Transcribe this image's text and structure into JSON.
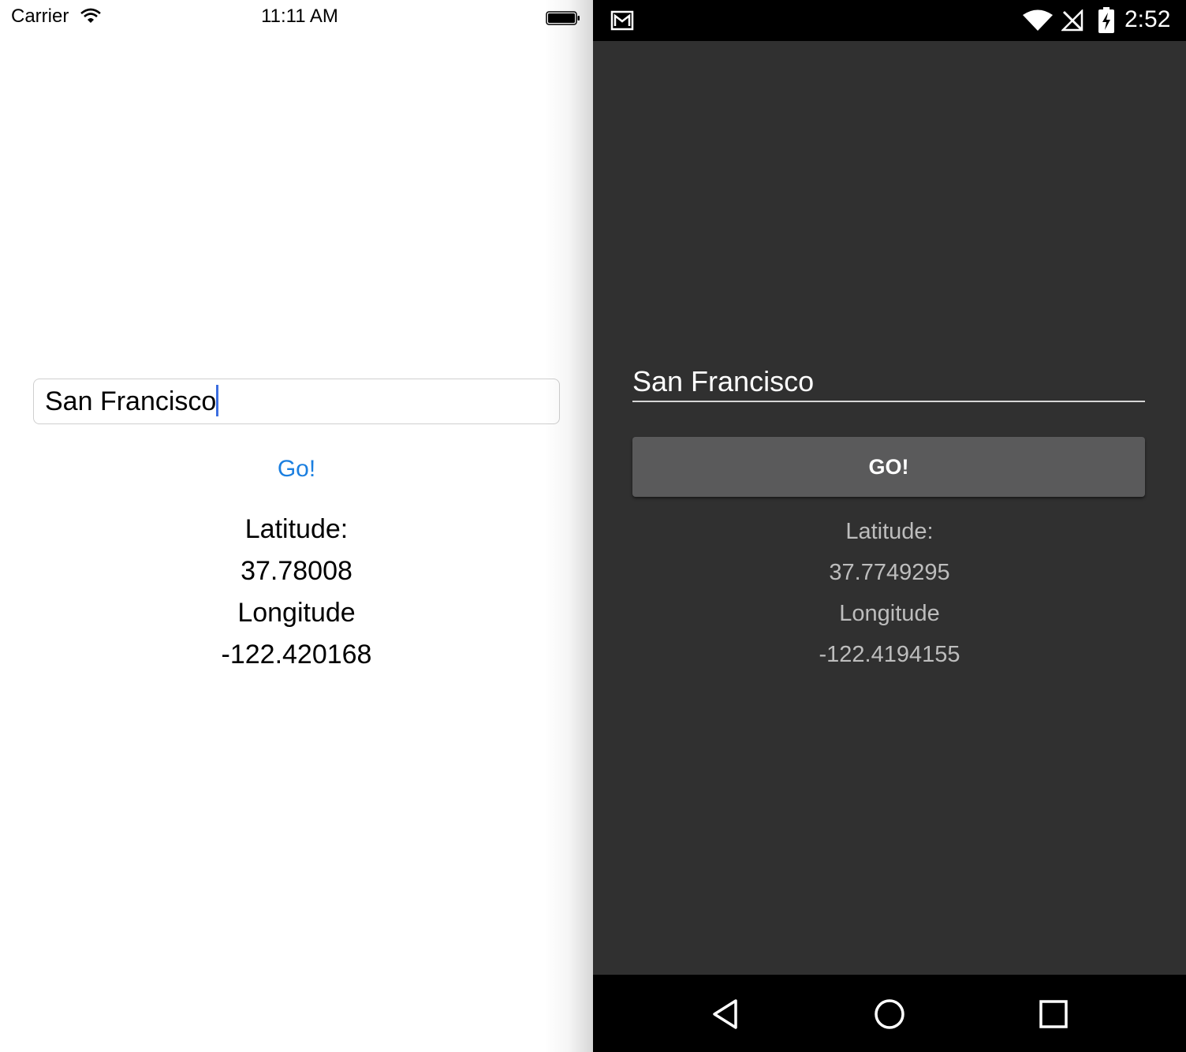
{
  "ios": {
    "status": {
      "carrier": "Carrier",
      "time": "11:11 AM"
    },
    "input_value": "San Francisco",
    "go_label": "Go!",
    "latitude_label": "Latitude:",
    "latitude_value": "37.78008",
    "longitude_label": "Longitude",
    "longitude_value": "-122.420168",
    "accent_color": "#1b7fe0"
  },
  "android": {
    "status": {
      "time": "2:52"
    },
    "input_value": "San Francisco",
    "go_label": "GO!",
    "latitude_label": "Latitude:",
    "latitude_value": "37.7749295",
    "longitude_label": "Longitude",
    "longitude_value": "-122.4194155",
    "background_color": "#303030",
    "button_color": "#5a5a5b"
  },
  "icons": {
    "ios": [
      "wifi-icon",
      "battery-icon"
    ],
    "android_status": [
      "mail-icon",
      "wifi-icon",
      "no-signal-icon",
      "battery-charging-icon"
    ],
    "android_nav": [
      "back-icon",
      "home-icon",
      "recents-icon"
    ]
  }
}
